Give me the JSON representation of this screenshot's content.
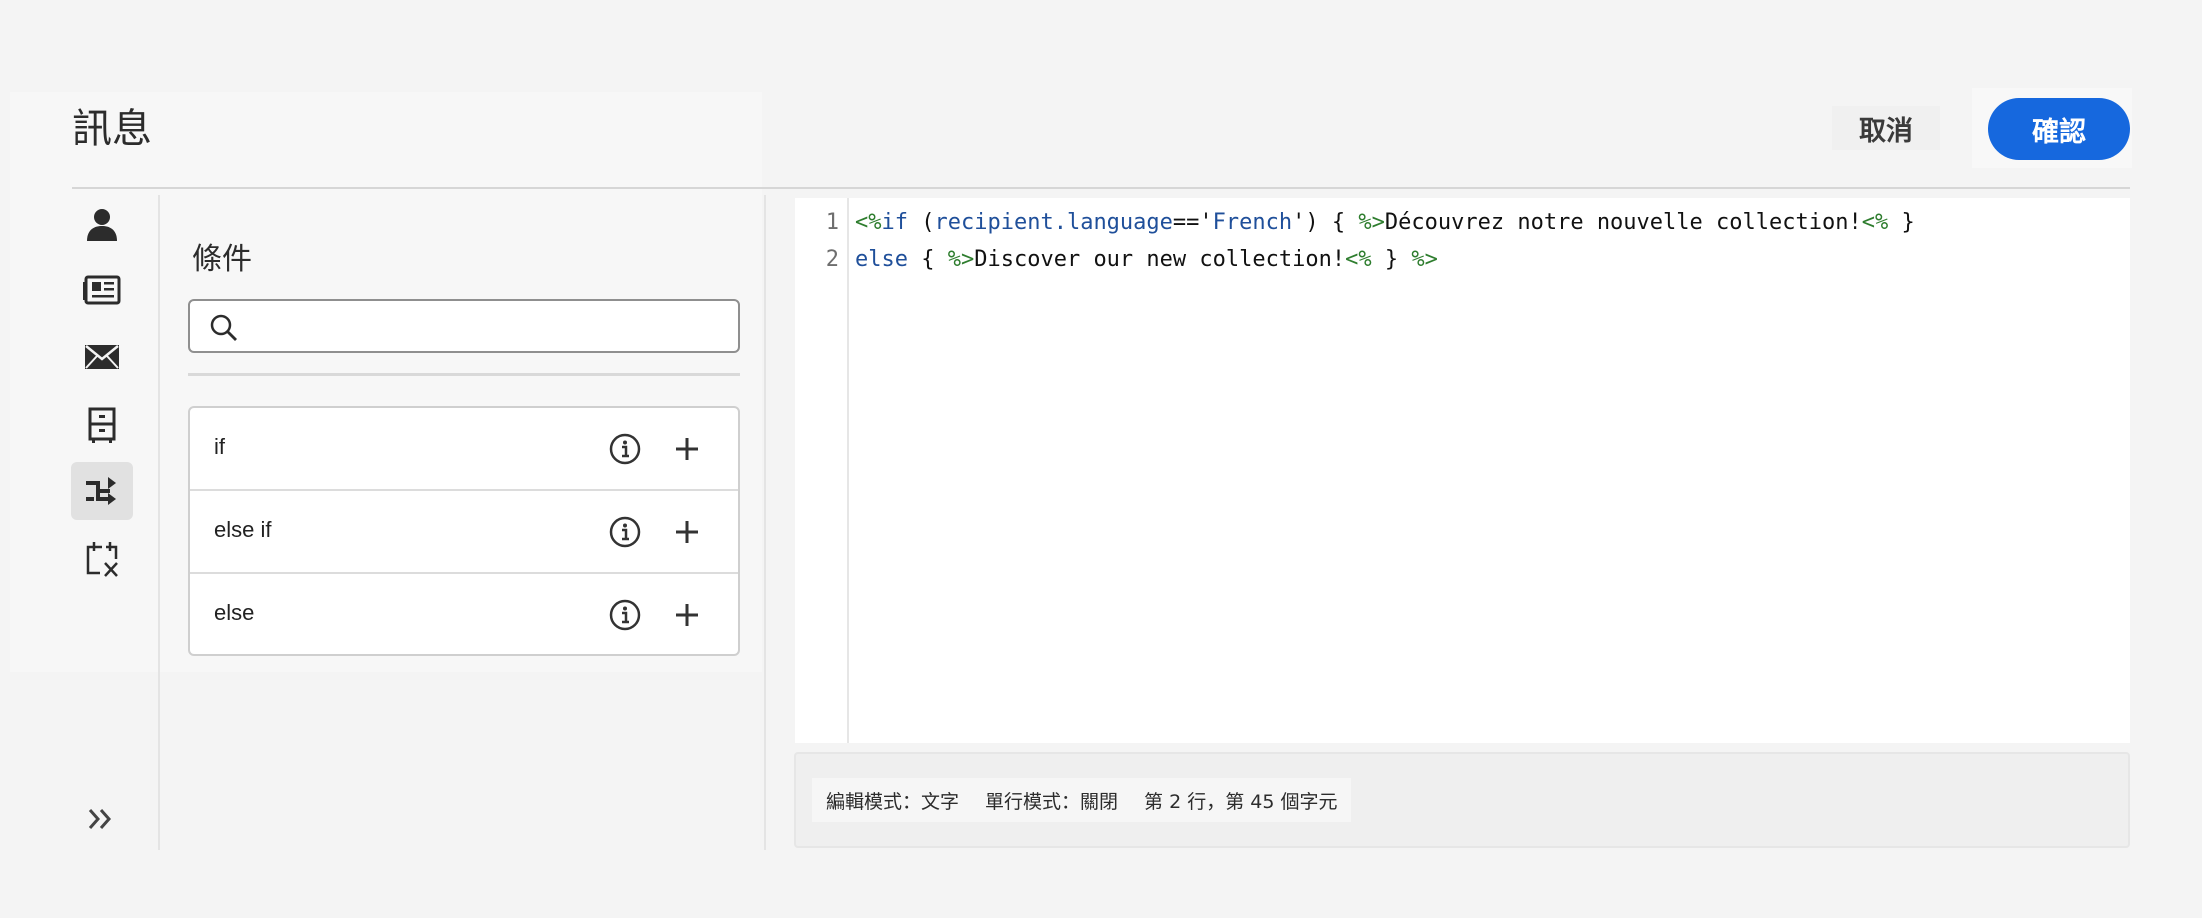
{
  "header": {
    "title": "訊息",
    "cancel_label": "取消",
    "confirm_label": "確認"
  },
  "rail": {
    "icons": [
      "person-icon",
      "newspaper-icon",
      "envelope-icon",
      "cabinet-icon",
      "branch-icon",
      "calendar-variable-icon"
    ],
    "active": "branch-icon",
    "expand_icon": "double-chevron-right-icon"
  },
  "panel": {
    "title": "條件",
    "search": {
      "placeholder": "",
      "value": ""
    },
    "conditions": [
      {
        "label": "if"
      },
      {
        "label": "else if"
      },
      {
        "label": "else"
      }
    ]
  },
  "editor": {
    "line_numbers": [
      "1",
      "2"
    ],
    "lines": [
      "<%if (recipient.language=='French') { %>Découvrez notre nouvelle collection!<% }",
      "else { %>Discover our new collection!<% } %>"
    ]
  },
  "status": {
    "edit_mode": "編輯模式：文字",
    "line_mode": "單行模式：關閉",
    "position": "第 2 行，第 45 個字元"
  },
  "colors": {
    "accent": "#1668de",
    "code_tag": "#2e7d2e",
    "code_keyword": "#1f4f9a"
  }
}
